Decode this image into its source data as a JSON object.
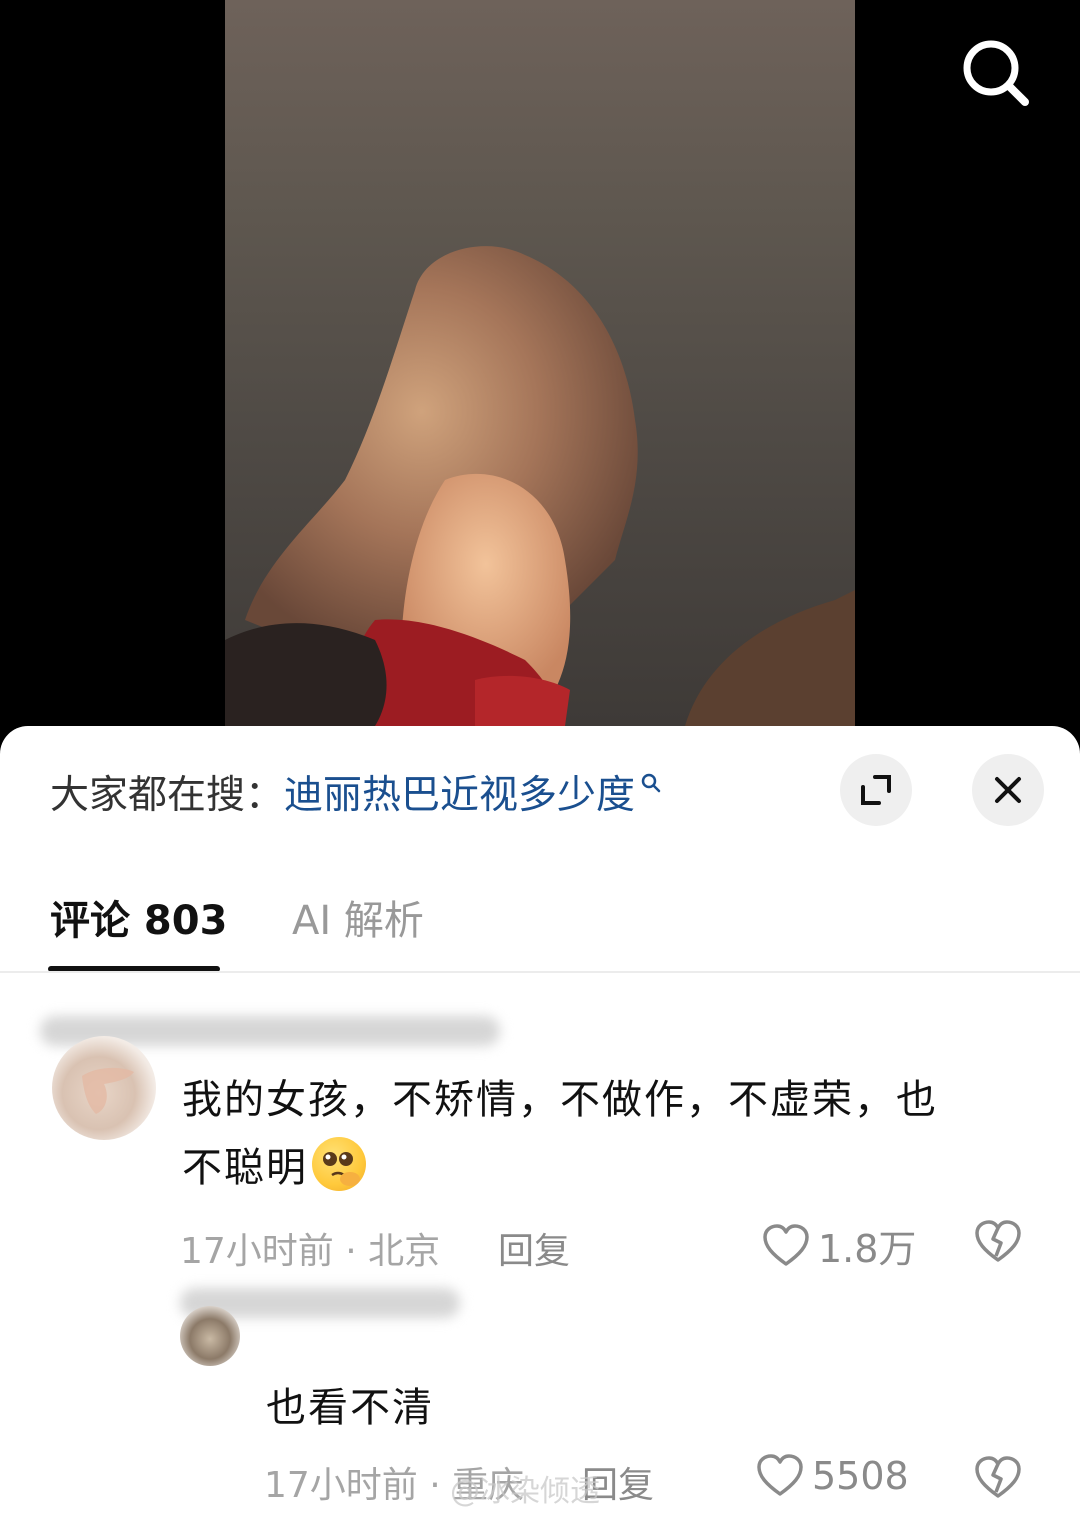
{
  "video": {
    "description_icon": "search-icon"
  },
  "sheet": {
    "suggest_prefix": "大家都在搜：",
    "suggest_query": "迪丽热巴近视多少度",
    "tabs": [
      {
        "label": "评论 803",
        "active": true
      },
      {
        "label": "AI 解析",
        "active": false
      }
    ]
  },
  "comments": [
    {
      "text_line1": "我的女孩，不矫情，不做作，不虚荣，也",
      "text_line2": "不聪明",
      "time_location": "17小时前 · 北京",
      "reply_label": "回复",
      "likes": "1.8万"
    },
    {
      "text": "也看不清",
      "time_location": "17小时前 · 重庆",
      "reply_label": "回复",
      "likes": "5508"
    }
  ],
  "watermark": "@冰染倾透",
  "colors": {
    "link_blue": "#1a4f8f",
    "gray_text": "#a5a5a5",
    "sheet_bg": "#ffffff"
  }
}
